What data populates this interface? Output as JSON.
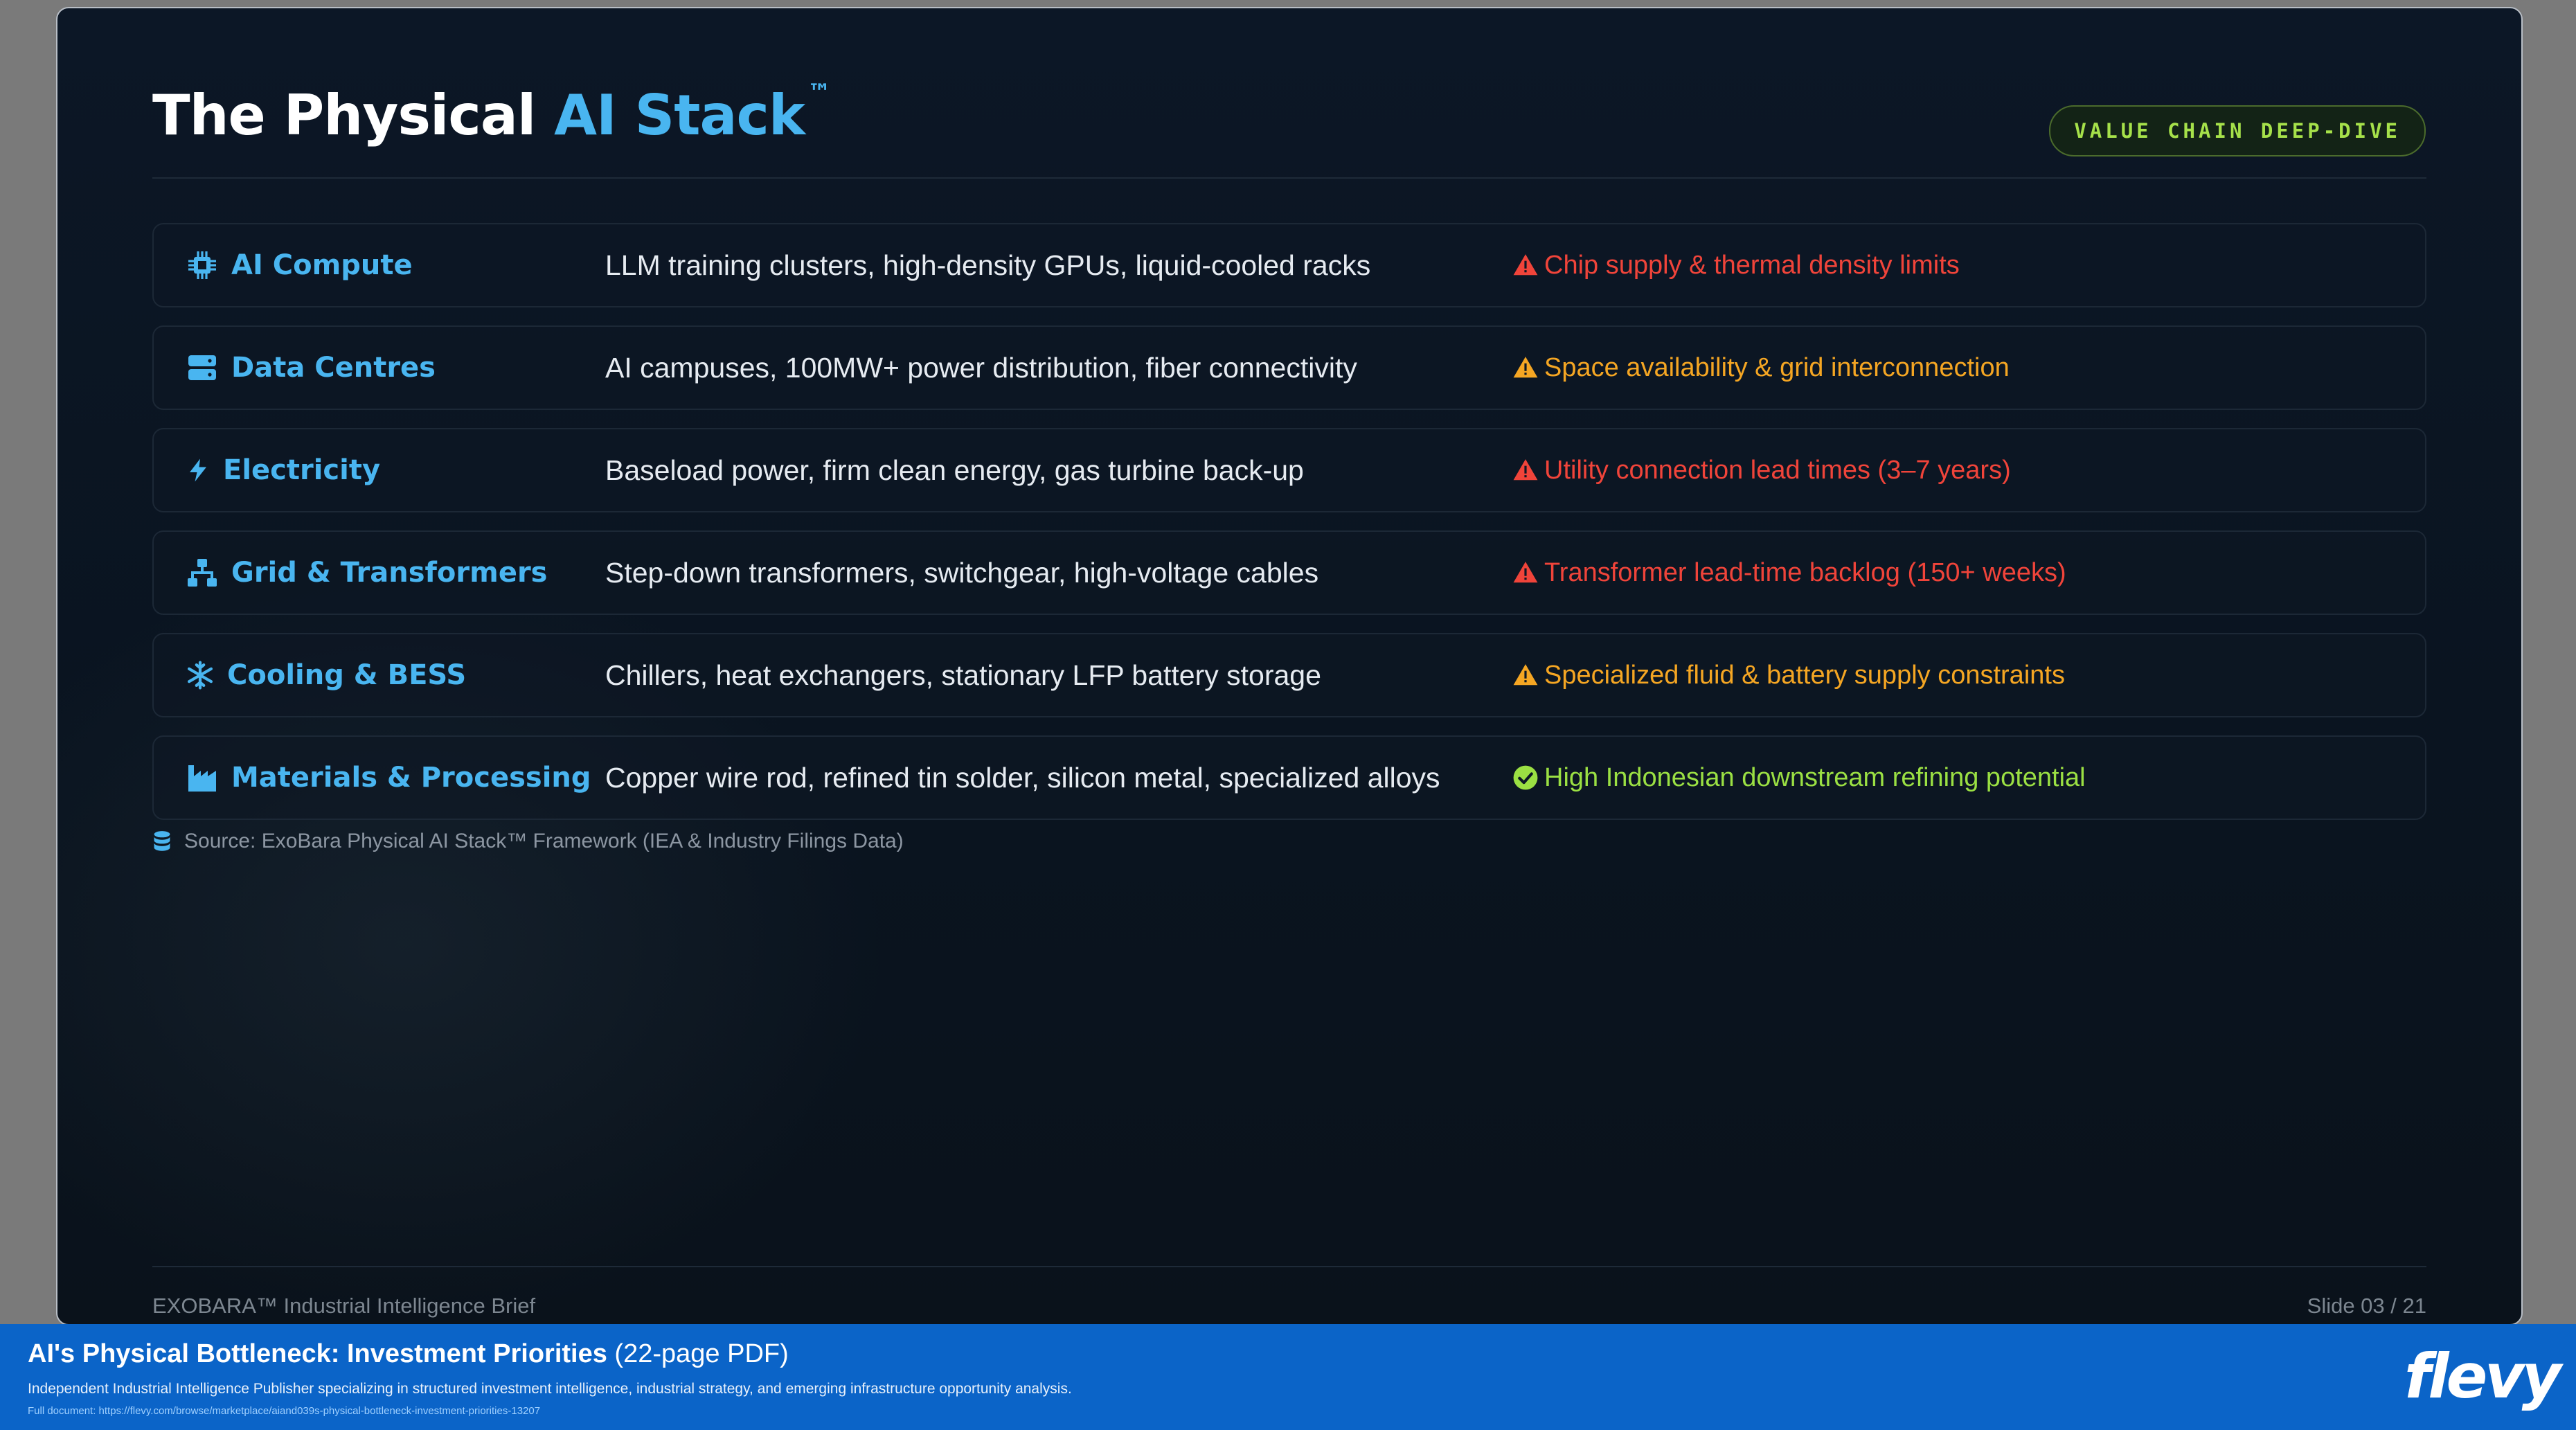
{
  "slide": {
    "title_part1": "The Physical ",
    "title_accent": "AI Stack",
    "title_tm": "™",
    "badge": "VALUE CHAIN DEEP-DIVE",
    "rows": [
      {
        "icon": "chip-icon",
        "category": "AI Compute",
        "description": "LLM training clusters, high-density GPUs, liquid-cooled racks",
        "risk_icon": "warning-triangle-icon",
        "risk": "Chip supply & thermal density limits",
        "risk_color": "#f0443a"
      },
      {
        "icon": "server-icon",
        "category": "Data Centres",
        "description": "AI campuses, 100MW+ power distribution, fiber connectivity",
        "risk_icon": "warning-triangle-icon",
        "risk": "Space availability & grid interconnection",
        "risk_color": "#f5a623"
      },
      {
        "icon": "bolt-icon",
        "category": "Electricity",
        "description": "Baseload power, firm clean energy, gas turbine back-up",
        "risk_icon": "warning-triangle-icon",
        "risk": "Utility connection lead times (3–7 years)",
        "risk_color": "#f0443a"
      },
      {
        "icon": "network-icon",
        "category": "Grid & Transformers",
        "description": "Step-down transformers, switchgear, high-voltage cables",
        "risk_icon": "warning-triangle-icon",
        "risk": "Transformer lead-time backlog (150+ weeks)",
        "risk_color": "#f0443a"
      },
      {
        "icon": "snowflake-icon",
        "category": "Cooling & BESS",
        "description": "Chillers, heat exchangers, stationary LFP battery storage",
        "risk_icon": "warning-triangle-icon",
        "risk": "Specialized fluid & battery supply constraints",
        "risk_color": "#f5a623"
      },
      {
        "icon": "factory-icon",
        "category": "Materials & Processing",
        "description": "Copper wire rod, refined tin solder, silicon metal, specialized alloys",
        "risk_icon": "check-circle-icon",
        "risk": "High Indonesian downstream refining potential",
        "risk_color": "#9be043"
      }
    ],
    "source": "Source: ExoBara Physical AI Stack™ Framework (IEA & Industry Filings Data)",
    "footer_left": "EXOBARA™ Industrial Intelligence Brief",
    "footer_right": "Slide 03 / 21"
  },
  "banner": {
    "title_bold": "AI's Physical Bottleneck: Investment Priorities",
    "title_rest": " (22-page PDF)",
    "subtitle": "Independent Industrial Intelligence Publisher specializing in structured investment intelligence, industrial strategy, and emerging infrastructure opportunity analysis.",
    "link": "Full document: https://flevy.com/browse/marketplace/aiand039s-physical-bottleneck-investment-priorities-13207",
    "logo": "flevy"
  },
  "colors": {
    "accent": "#49b5f0",
    "badge_green": "#a6e14a",
    "risk_red": "#f0443a",
    "risk_amber": "#f5a623",
    "ok_green": "#9be043",
    "banner_blue": "#0b64c8"
  }
}
